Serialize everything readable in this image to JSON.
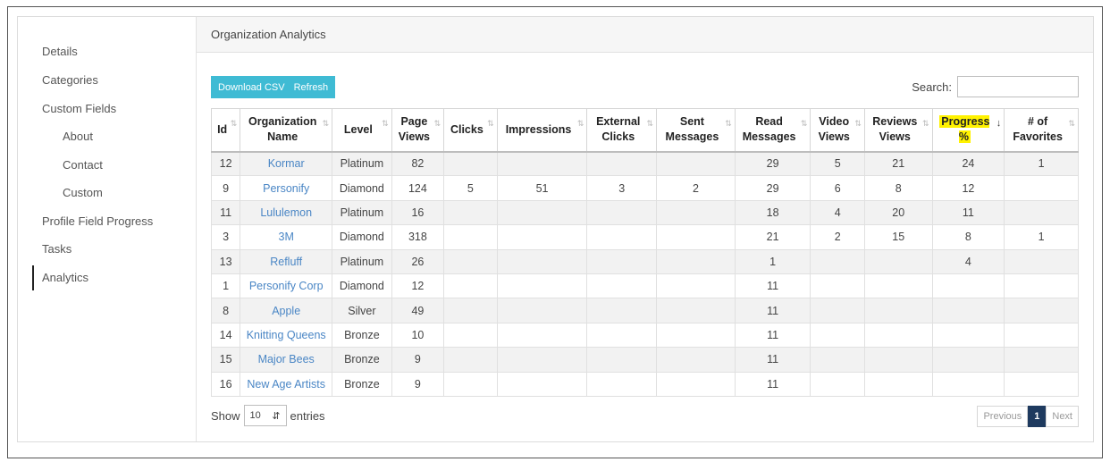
{
  "sidebar": {
    "items": [
      {
        "label": "Details"
      },
      {
        "label": "Categories"
      },
      {
        "label": "Custom Fields"
      },
      {
        "label": "About"
      },
      {
        "label": "Contact"
      },
      {
        "label": "Custom"
      },
      {
        "label": "Profile Field Progress"
      },
      {
        "label": "Tasks"
      },
      {
        "label": "Analytics"
      }
    ]
  },
  "panel": {
    "title": "Organization Analytics"
  },
  "toolbar": {
    "download_label": "Download CSV",
    "refresh_label": "Refresh"
  },
  "search": {
    "label": "Search:",
    "value": ""
  },
  "table": {
    "columns": [
      {
        "l1": "Id",
        "l2": ""
      },
      {
        "l1": "Organization",
        "l2": "Name"
      },
      {
        "l1": "Level",
        "l2": ""
      },
      {
        "l1": "Page",
        "l2": "Views"
      },
      {
        "l1": "Clicks",
        "l2": ""
      },
      {
        "l1": "Impressions",
        "l2": ""
      },
      {
        "l1": "External",
        "l2": "Clicks"
      },
      {
        "l1": "Sent",
        "l2": "Messages"
      },
      {
        "l1": "Read",
        "l2": "Messages"
      },
      {
        "l1": "Video",
        "l2": "Views"
      },
      {
        "l1": "Reviews",
        "l2": "Views"
      },
      {
        "l1": "Progress",
        "l2": "%"
      },
      {
        "l1": "# of",
        "l2": "Favorites"
      }
    ],
    "rows": [
      [
        "12",
        "Kormar",
        "Platinum",
        "82",
        "",
        "",
        "",
        "",
        "29",
        "5",
        "21",
        "24",
        "1"
      ],
      [
        "9",
        "Personify",
        "Diamond",
        "124",
        "5",
        "51",
        "3",
        "2",
        "29",
        "6",
        "8",
        "12",
        ""
      ],
      [
        "11",
        "Lululemon",
        "Platinum",
        "16",
        "",
        "",
        "",
        "",
        "18",
        "4",
        "20",
        "11",
        ""
      ],
      [
        "3",
        "3M",
        "Diamond",
        "318",
        "",
        "",
        "",
        "",
        "21",
        "2",
        "15",
        "8",
        "1"
      ],
      [
        "13",
        "Refluff",
        "Platinum",
        "26",
        "",
        "",
        "",
        "",
        "1",
        "",
        "",
        "4",
        ""
      ],
      [
        "1",
        "Personify Corp",
        "Diamond",
        "12",
        "",
        "",
        "",
        "",
        "11",
        "",
        "",
        "",
        ""
      ],
      [
        "8",
        "Apple",
        "Silver",
        "49",
        "",
        "",
        "",
        "",
        "11",
        "",
        "",
        "",
        ""
      ],
      [
        "14",
        "Knitting Queens",
        "Bronze",
        "10",
        "",
        "",
        "",
        "",
        "11",
        "",
        "",
        "",
        ""
      ],
      [
        "15",
        "Major Bees",
        "Bronze",
        "9",
        "",
        "",
        "",
        "",
        "11",
        "",
        "",
        "",
        ""
      ],
      [
        "16",
        "New Age Artists",
        "Bronze",
        "9",
        "",
        "",
        "",
        "",
        "11",
        "",
        "",
        "",
        ""
      ]
    ]
  },
  "length": {
    "show_label": "Show",
    "value": "10",
    "entries_label": "entries"
  },
  "pager": {
    "previous": "Previous",
    "current": "1",
    "next": "Next"
  },
  "icons": {
    "sort": "sort-arrows-icon",
    "sort_active": "sort-descending-icon",
    "select": "updown-caret-icon"
  },
  "colors": {
    "accent": "#3fbbd4",
    "link": "#4a86c5",
    "highlight": "#fff200",
    "pager_active": "#1e3a5f"
  }
}
